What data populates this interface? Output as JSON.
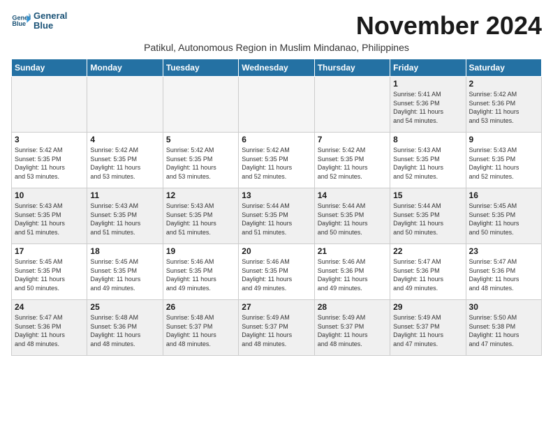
{
  "logo": {
    "line1": "General",
    "line2": "Blue"
  },
  "title": "November 2024",
  "subtitle": "Patikul, Autonomous Region in Muslim Mindanao, Philippines",
  "days_of_week": [
    "Sunday",
    "Monday",
    "Tuesday",
    "Wednesday",
    "Thursday",
    "Friday",
    "Saturday"
  ],
  "weeks": [
    [
      {
        "day": "",
        "info": ""
      },
      {
        "day": "",
        "info": ""
      },
      {
        "day": "",
        "info": ""
      },
      {
        "day": "",
        "info": ""
      },
      {
        "day": "",
        "info": ""
      },
      {
        "day": "1",
        "info": "Sunrise: 5:41 AM\nSunset: 5:36 PM\nDaylight: 11 hours\nand 54 minutes."
      },
      {
        "day": "2",
        "info": "Sunrise: 5:42 AM\nSunset: 5:36 PM\nDaylight: 11 hours\nand 53 minutes."
      }
    ],
    [
      {
        "day": "3",
        "info": "Sunrise: 5:42 AM\nSunset: 5:35 PM\nDaylight: 11 hours\nand 53 minutes."
      },
      {
        "day": "4",
        "info": "Sunrise: 5:42 AM\nSunset: 5:35 PM\nDaylight: 11 hours\nand 53 minutes."
      },
      {
        "day": "5",
        "info": "Sunrise: 5:42 AM\nSunset: 5:35 PM\nDaylight: 11 hours\nand 53 minutes."
      },
      {
        "day": "6",
        "info": "Sunrise: 5:42 AM\nSunset: 5:35 PM\nDaylight: 11 hours\nand 52 minutes."
      },
      {
        "day": "7",
        "info": "Sunrise: 5:42 AM\nSunset: 5:35 PM\nDaylight: 11 hours\nand 52 minutes."
      },
      {
        "day": "8",
        "info": "Sunrise: 5:43 AM\nSunset: 5:35 PM\nDaylight: 11 hours\nand 52 minutes."
      },
      {
        "day": "9",
        "info": "Sunrise: 5:43 AM\nSunset: 5:35 PM\nDaylight: 11 hours\nand 52 minutes."
      }
    ],
    [
      {
        "day": "10",
        "info": "Sunrise: 5:43 AM\nSunset: 5:35 PM\nDaylight: 11 hours\nand 51 minutes."
      },
      {
        "day": "11",
        "info": "Sunrise: 5:43 AM\nSunset: 5:35 PM\nDaylight: 11 hours\nand 51 minutes."
      },
      {
        "day": "12",
        "info": "Sunrise: 5:43 AM\nSunset: 5:35 PM\nDaylight: 11 hours\nand 51 minutes."
      },
      {
        "day": "13",
        "info": "Sunrise: 5:44 AM\nSunset: 5:35 PM\nDaylight: 11 hours\nand 51 minutes."
      },
      {
        "day": "14",
        "info": "Sunrise: 5:44 AM\nSunset: 5:35 PM\nDaylight: 11 hours\nand 50 minutes."
      },
      {
        "day": "15",
        "info": "Sunrise: 5:44 AM\nSunset: 5:35 PM\nDaylight: 11 hours\nand 50 minutes."
      },
      {
        "day": "16",
        "info": "Sunrise: 5:45 AM\nSunset: 5:35 PM\nDaylight: 11 hours\nand 50 minutes."
      }
    ],
    [
      {
        "day": "17",
        "info": "Sunrise: 5:45 AM\nSunset: 5:35 PM\nDaylight: 11 hours\nand 50 minutes."
      },
      {
        "day": "18",
        "info": "Sunrise: 5:45 AM\nSunset: 5:35 PM\nDaylight: 11 hours\nand 49 minutes."
      },
      {
        "day": "19",
        "info": "Sunrise: 5:46 AM\nSunset: 5:35 PM\nDaylight: 11 hours\nand 49 minutes."
      },
      {
        "day": "20",
        "info": "Sunrise: 5:46 AM\nSunset: 5:35 PM\nDaylight: 11 hours\nand 49 minutes."
      },
      {
        "day": "21",
        "info": "Sunrise: 5:46 AM\nSunset: 5:36 PM\nDaylight: 11 hours\nand 49 minutes."
      },
      {
        "day": "22",
        "info": "Sunrise: 5:47 AM\nSunset: 5:36 PM\nDaylight: 11 hours\nand 49 minutes."
      },
      {
        "day": "23",
        "info": "Sunrise: 5:47 AM\nSunset: 5:36 PM\nDaylight: 11 hours\nand 48 minutes."
      }
    ],
    [
      {
        "day": "24",
        "info": "Sunrise: 5:47 AM\nSunset: 5:36 PM\nDaylight: 11 hours\nand 48 minutes."
      },
      {
        "day": "25",
        "info": "Sunrise: 5:48 AM\nSunset: 5:36 PM\nDaylight: 11 hours\nand 48 minutes."
      },
      {
        "day": "26",
        "info": "Sunrise: 5:48 AM\nSunset: 5:37 PM\nDaylight: 11 hours\nand 48 minutes."
      },
      {
        "day": "27",
        "info": "Sunrise: 5:49 AM\nSunset: 5:37 PM\nDaylight: 11 hours\nand 48 minutes."
      },
      {
        "day": "28",
        "info": "Sunrise: 5:49 AM\nSunset: 5:37 PM\nDaylight: 11 hours\nand 48 minutes."
      },
      {
        "day": "29",
        "info": "Sunrise: 5:49 AM\nSunset: 5:37 PM\nDaylight: 11 hours\nand 47 minutes."
      },
      {
        "day": "30",
        "info": "Sunrise: 5:50 AM\nSunset: 5:38 PM\nDaylight: 11 hours\nand 47 minutes."
      }
    ]
  ]
}
